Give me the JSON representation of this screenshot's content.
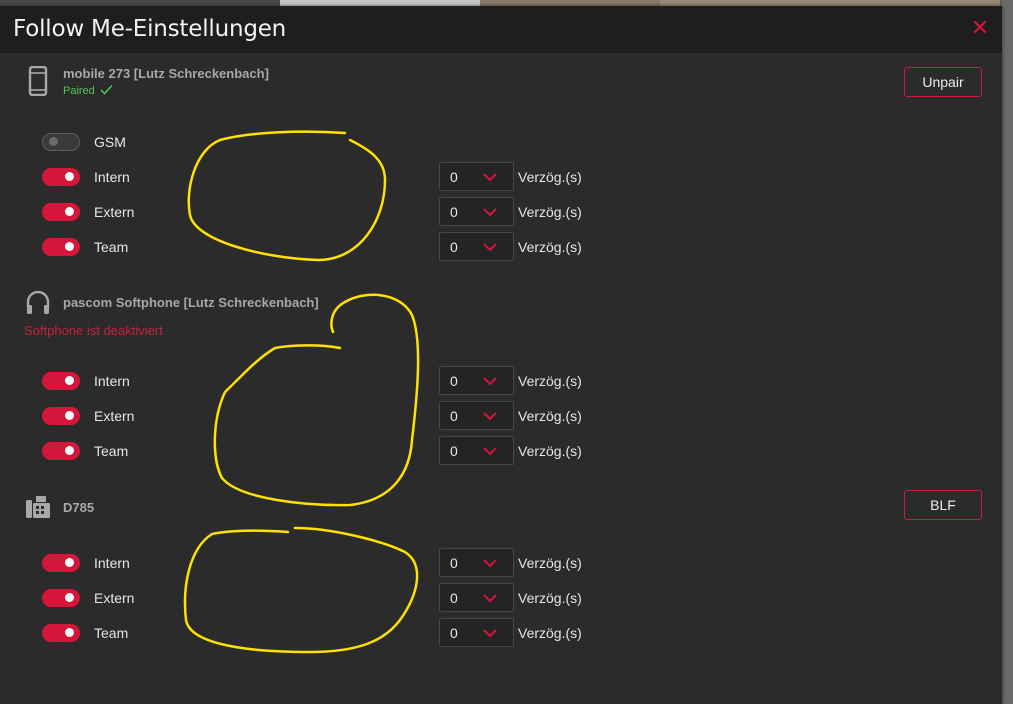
{
  "dialog": {
    "title": "Follow Me-Einstellungen",
    "close_icon": "close-icon"
  },
  "devices": [
    {
      "icon": "mobile-phone-icon",
      "name": "mobile 273 [Lutz Schreckenbach]",
      "status": "Paired",
      "status_icon": "checkmark-icon",
      "button_label": "Unpair",
      "rows": [
        {
          "label": "GSM",
          "enabled": false
        },
        {
          "label": "Intern",
          "enabled": true,
          "delay": "0",
          "delay_label": "Verzög.(s)"
        },
        {
          "label": "Extern",
          "enabled": true,
          "delay": "0",
          "delay_label": "Verzög.(s)"
        },
        {
          "label": "Team",
          "enabled": true,
          "delay": "0",
          "delay_label": "Verzög.(s)"
        }
      ]
    },
    {
      "icon": "headset-icon",
      "name": "pascom Softphone [Lutz Schreckenbach]",
      "warning": "Softphone ist deaktiviert",
      "rows": [
        {
          "label": "Intern",
          "enabled": true,
          "delay": "0",
          "delay_label": "Verzög.(s)"
        },
        {
          "label": "Extern",
          "enabled": true,
          "delay": "0",
          "delay_label": "Verzög.(s)"
        },
        {
          "label": "Team",
          "enabled": true,
          "delay": "0",
          "delay_label": "Verzög.(s)"
        }
      ]
    },
    {
      "icon": "desk-phone-icon",
      "name": "D785",
      "button_label": "BLF",
      "rows": [
        {
          "label": "Intern",
          "enabled": true,
          "delay": "0",
          "delay_label": "Verzög.(s)"
        },
        {
          "label": "Extern",
          "enabled": true,
          "delay": "0",
          "delay_label": "Verzög.(s)"
        },
        {
          "label": "Team",
          "enabled": true,
          "delay": "0",
          "delay_label": "Verzög.(s)"
        }
      ]
    }
  ],
  "colors": {
    "accent": "#d6153a",
    "paired": "#4fc65a",
    "annotation": "#ffe100"
  }
}
